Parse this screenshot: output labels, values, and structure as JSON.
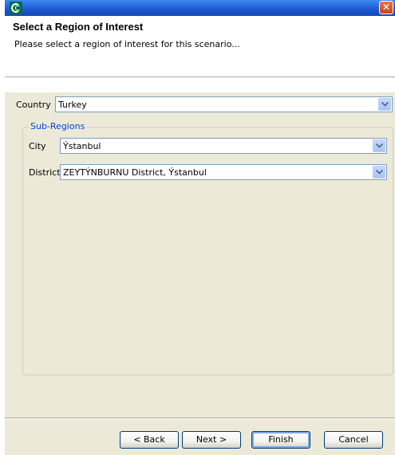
{
  "window": {
    "close_glyph": "✕"
  },
  "header": {
    "title": "Select a Region of Interest",
    "description": "Please select a region of interest for this scenario..."
  },
  "country": {
    "label": "Country",
    "value": "Turkey"
  },
  "subregions": {
    "title": "Sub-Regions",
    "city": {
      "label": "City",
      "value": "Ýstanbul"
    },
    "district": {
      "label": "District",
      "value": "ZEYTÝNBURNU District, Ýstanbul"
    }
  },
  "buttons": {
    "back": "< Back",
    "next": "Next >",
    "finish": "Finish",
    "cancel": "Cancel"
  },
  "colors": {
    "titlebar": "#1752c9",
    "group_title": "#0046d5",
    "dialog_bg": "#ece9d8"
  }
}
